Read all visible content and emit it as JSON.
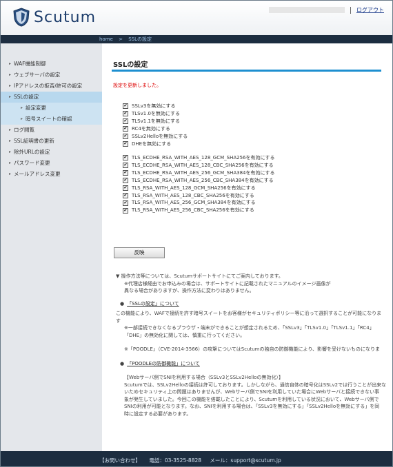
{
  "app": {
    "logo_text": "Scutum",
    "logout": "ログアウト"
  },
  "breadcrumb": {
    "home": "home",
    "sep": ">",
    "current": "SSLの設定"
  },
  "sidebar": {
    "items": [
      {
        "label": "WAF機能制御"
      },
      {
        "label": "ウェブサーバの設定"
      },
      {
        "label": "IPアドレスの拒否/許可の設定"
      },
      {
        "label": "SSLの設定",
        "active": true
      },
      {
        "label": "設定変更",
        "sub": true
      },
      {
        "label": "暗号スイートの確認",
        "sub": true
      },
      {
        "label": "ログ閲覧"
      },
      {
        "label": "SSL証明書の更新"
      },
      {
        "label": "除外URLの設定"
      },
      {
        "label": "パスワード変更"
      },
      {
        "label": "メールアドレス変更"
      }
    ]
  },
  "main": {
    "title": "SSLの設定",
    "notice": "設定を更新しました。",
    "protocols": [
      "SSLv3を無効にする",
      "TLSv1.0を無効にする",
      "TLSv1.1を無効にする",
      "RC4を無効にする",
      "SSLv2Helloを無効にする",
      "DHEを無効にする"
    ],
    "ciphers": [
      "TLS_ECDHE_RSA_WITH_AES_128_GCM_SHA256を有効にする",
      "TLS_ECDHE_RSA_WITH_AES_128_CBC_SHA256を有効にする",
      "TLS_ECDHE_RSA_WITH_AES_256_GCM_SHA384を有効にする",
      "TLS_ECDHE_RSA_WITH_AES_256_CBC_SHA384を有効にする",
      "TLS_RSA_WITH_AES_128_GCM_SHA256を有効にする",
      "TLS_RSA_WITH_AES_128_CBC_SHA256を有効にする",
      "TLS_RSA_WITH_AES_256_GCM_SHA384を有効にする",
      "TLS_RSA_WITH_AES_256_CBC_SHA256を有効にする"
    ],
    "apply_label": "反映"
  },
  "info": {
    "line1": "▼ 操作方法等については、Scutumサポートサイトにてご案内しております。",
    "line2": "※代理店様経由でお申込みの場合は、サポートサイトに記載されたマニュアルのイメージ画像が",
    "line3": "異なる場合がありますが、操作方法に変わりはありません。",
    "link1": "「SSLの設定」について",
    "para1_1": "この機能により、WAFで接続を許す暗号スイートをお客様がセキュリティポリシー等に沿って選択することが可能になりま",
    "para1_2": "す",
    "para1_3": "※一部接続できなくなるブラウザ・端末ができることが想定されるため、「SSLv3」「TLSv1.0」「TLSv1.1」「RC4」",
    "para1_4": "「DHE」の無効化に関しては、慎重に行ってください。",
    "para1_5": "※「POODLE」（CVE-2014-3566）の攻撃についてはScutumの独自の防御機能により、影響を受けないものになりま",
    "link2": "「POODLEの防御機能」について",
    "para2_1": "【Webサーバ側でSNIを利用する場合（SSLv3とSSLv2Helloの無効化）】",
    "para2_2": "Scutumでは、SSLv2Helloの接続は許可しております。しかしながら、通信自体の暗号化はSSLv2では行うことが出来な",
    "para2_3": "いためセキュリティ上の問題はありませんが、Webサーバ側でSNIを利用していた場合にWebサーバと接続できない事",
    "para2_4": "象が発生していました。今回この機能を搭載したことにより、Scutumを利用している状況において、Webサーバ側で",
    "para2_5": "SNIの利用が可能となります。なお、SNIを利用する場合は、「SSLv3を無効にする」「SSLv2Helloを無効にする」を同",
    "para2_6": "時に設定する必要があります。"
  },
  "footer": {
    "contact": "【お問い合わせ】",
    "phone": "電話：03-3525-8828",
    "email": "メール：support@scutum.jp"
  },
  "colors": {
    "accent": "#1d8fd0",
    "dark_bar": "#1c2d40",
    "notice": "#dd0000"
  }
}
